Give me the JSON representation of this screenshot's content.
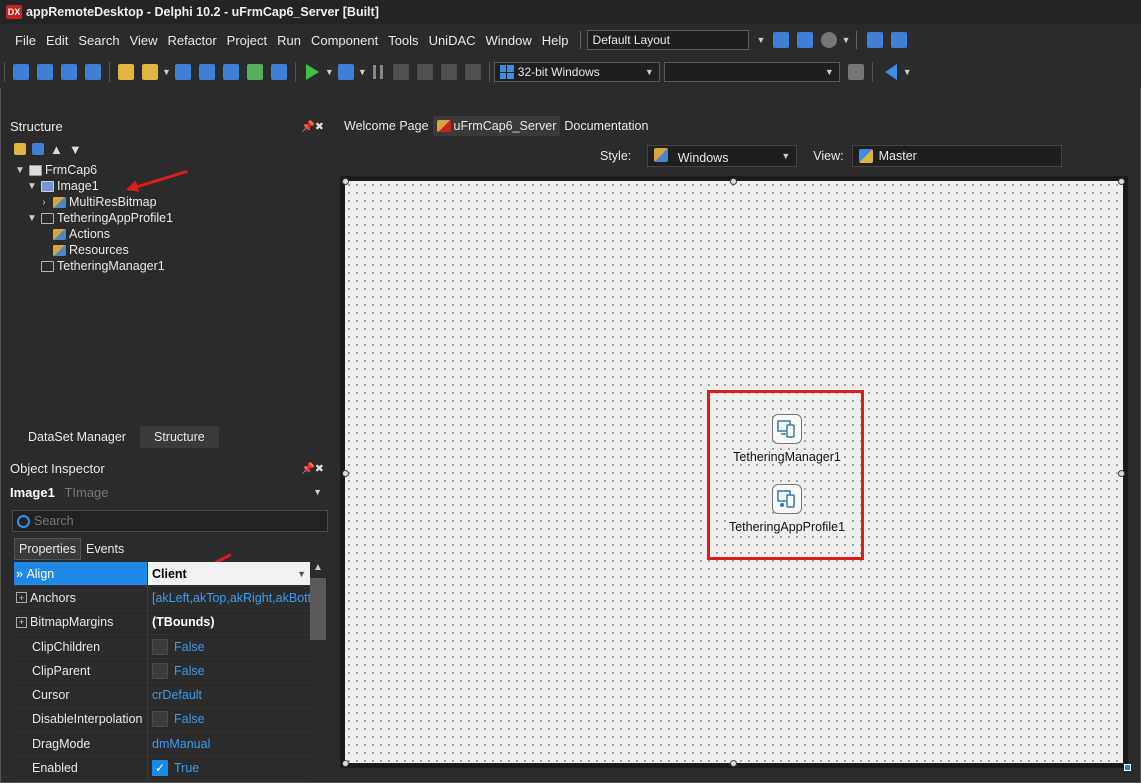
{
  "window": {
    "title": "appRemoteDesktop - Delphi 10.2 - uFrmCap6_Server [Built]",
    "logo_text": "DX"
  },
  "menu": [
    "File",
    "Edit",
    "Search",
    "View",
    "Refactor",
    "Project",
    "Run",
    "Component",
    "Tools",
    "UniDAC",
    "Window",
    "Help"
  ],
  "layout_combo": "Default Layout",
  "toolbar": {
    "platform": "32-bit Windows",
    "config": ""
  },
  "structure": {
    "title": "Structure",
    "tree": [
      {
        "label": "FrmCap6",
        "level": 0,
        "twisty": "expanded",
        "icon": "form-icon"
      },
      {
        "label": "Image1",
        "level": 1,
        "twisty": "expanded",
        "icon": "image-icon"
      },
      {
        "label": "MultiResBitmap",
        "level": 2,
        "twisty": "collapsed",
        "icon": "resource-icon"
      },
      {
        "label": "TetheringAppProfile1",
        "level": 1,
        "twisty": "expanded",
        "icon": "tethering-icon"
      },
      {
        "label": "Actions",
        "level": 2,
        "twisty": "none",
        "icon": "resource-icon"
      },
      {
        "label": "Resources",
        "level": 2,
        "twisty": "none",
        "icon": "resource-icon"
      },
      {
        "label": "TetheringManager1",
        "level": 1,
        "twisty": "none",
        "icon": "tethering-icon"
      }
    ]
  },
  "bottom_tabs": [
    "DataSet Manager",
    "Structure"
  ],
  "object_inspector": {
    "title": "Object Inspector",
    "selected_name": "Image1",
    "selected_class": "TImage",
    "search_placeholder": "Search",
    "tabs": [
      "Properties",
      "Events"
    ],
    "properties": [
      {
        "name": "Align",
        "value": "Client",
        "selected": true,
        "marker": "»"
      },
      {
        "name": "Anchors",
        "value": "[akLeft,akTop,akRight,akBottom]",
        "expandable": true
      },
      {
        "name": "BitmapMargins",
        "value": "(TBounds)",
        "expandable": true,
        "bold": true
      },
      {
        "name": "ClipChildren",
        "value": "False",
        "checkbox": false
      },
      {
        "name": "ClipParent",
        "value": "False",
        "checkbox": false
      },
      {
        "name": "Cursor",
        "value": "crDefault"
      },
      {
        "name": "DisableInterpolation",
        "value": "False",
        "checkbox": false
      },
      {
        "name": "DragMode",
        "value": "dmManual"
      },
      {
        "name": "Enabled",
        "value": "True",
        "checkbox": true
      }
    ]
  },
  "designer": {
    "tabs": [
      "Welcome Page",
      "uFrmCap6_Server",
      "Documentation"
    ],
    "style_label": "Style:",
    "style_value": "Windows",
    "view_label": "View:",
    "view_value": "Master",
    "components": [
      {
        "label": "TetheringManager1",
        "icon": "tethering-manager-icon"
      },
      {
        "label": "TetheringAppProfile1",
        "icon": "tethering-app-profile-icon"
      }
    ]
  }
}
